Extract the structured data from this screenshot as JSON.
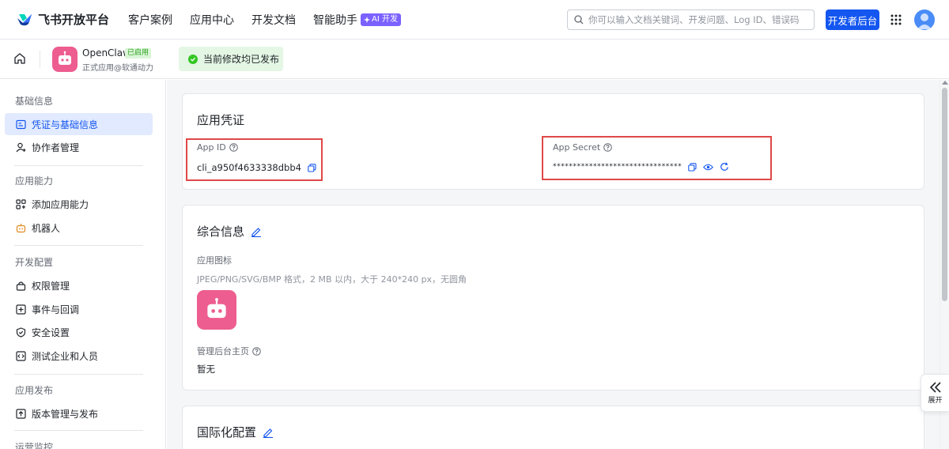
{
  "brand": {
    "name": "飞书开放平台"
  },
  "nav": [
    {
      "label": "客户案例"
    },
    {
      "label": "应用中心"
    },
    {
      "label": "开发文档"
    },
    {
      "label": "智能助手",
      "badge": "AI 开发"
    }
  ],
  "search": {
    "placeholder": "你可以输入文档关键词、开发问题、Log ID、错误码"
  },
  "header": {
    "dev_console": "开发者后台"
  },
  "app": {
    "name": "OpenClaw",
    "status_badge": "已启用",
    "subtitle": "正式应用@软通动力"
  },
  "banner": {
    "text": "当前修改均已发布"
  },
  "sidebar": {
    "groups": [
      {
        "label": "基础信息",
        "items": [
          {
            "label": "凭证与基础信息",
            "active": true
          },
          {
            "label": "协作者管理"
          }
        ]
      },
      {
        "label": "应用能力",
        "items": [
          {
            "label": "添加应用能力"
          },
          {
            "label": "机器人"
          }
        ]
      },
      {
        "label": "开发配置",
        "items": [
          {
            "label": "权限管理"
          },
          {
            "label": "事件与回调"
          },
          {
            "label": "安全设置"
          },
          {
            "label": "测试企业和人员"
          }
        ]
      },
      {
        "label": "应用发布",
        "items": [
          {
            "label": "版本管理与发布"
          }
        ]
      },
      {
        "label": "运营监控",
        "items": []
      }
    ]
  },
  "credentials": {
    "title": "应用凭证",
    "app_id_label": "App ID",
    "app_id_value": "cli_a950f4633338dbb4",
    "app_secret_label": "App Secret",
    "app_secret_value": "********************************"
  },
  "general": {
    "title": "综合信息",
    "icon_label": "应用图标",
    "icon_hint": "JPEG/PNG/SVG/BMP 格式，2 MB 以内，大于 240*240 px，无圆角",
    "homepage_label": "管理后台主页",
    "homepage_value": "暂无"
  },
  "i18n": {
    "title": "国际化配置"
  },
  "expand": {
    "label": "展开"
  },
  "colors": {
    "primary": "#1456f0",
    "app_icon": "#ed5d8f",
    "highlight": "#e04848",
    "success": "#34c724"
  }
}
